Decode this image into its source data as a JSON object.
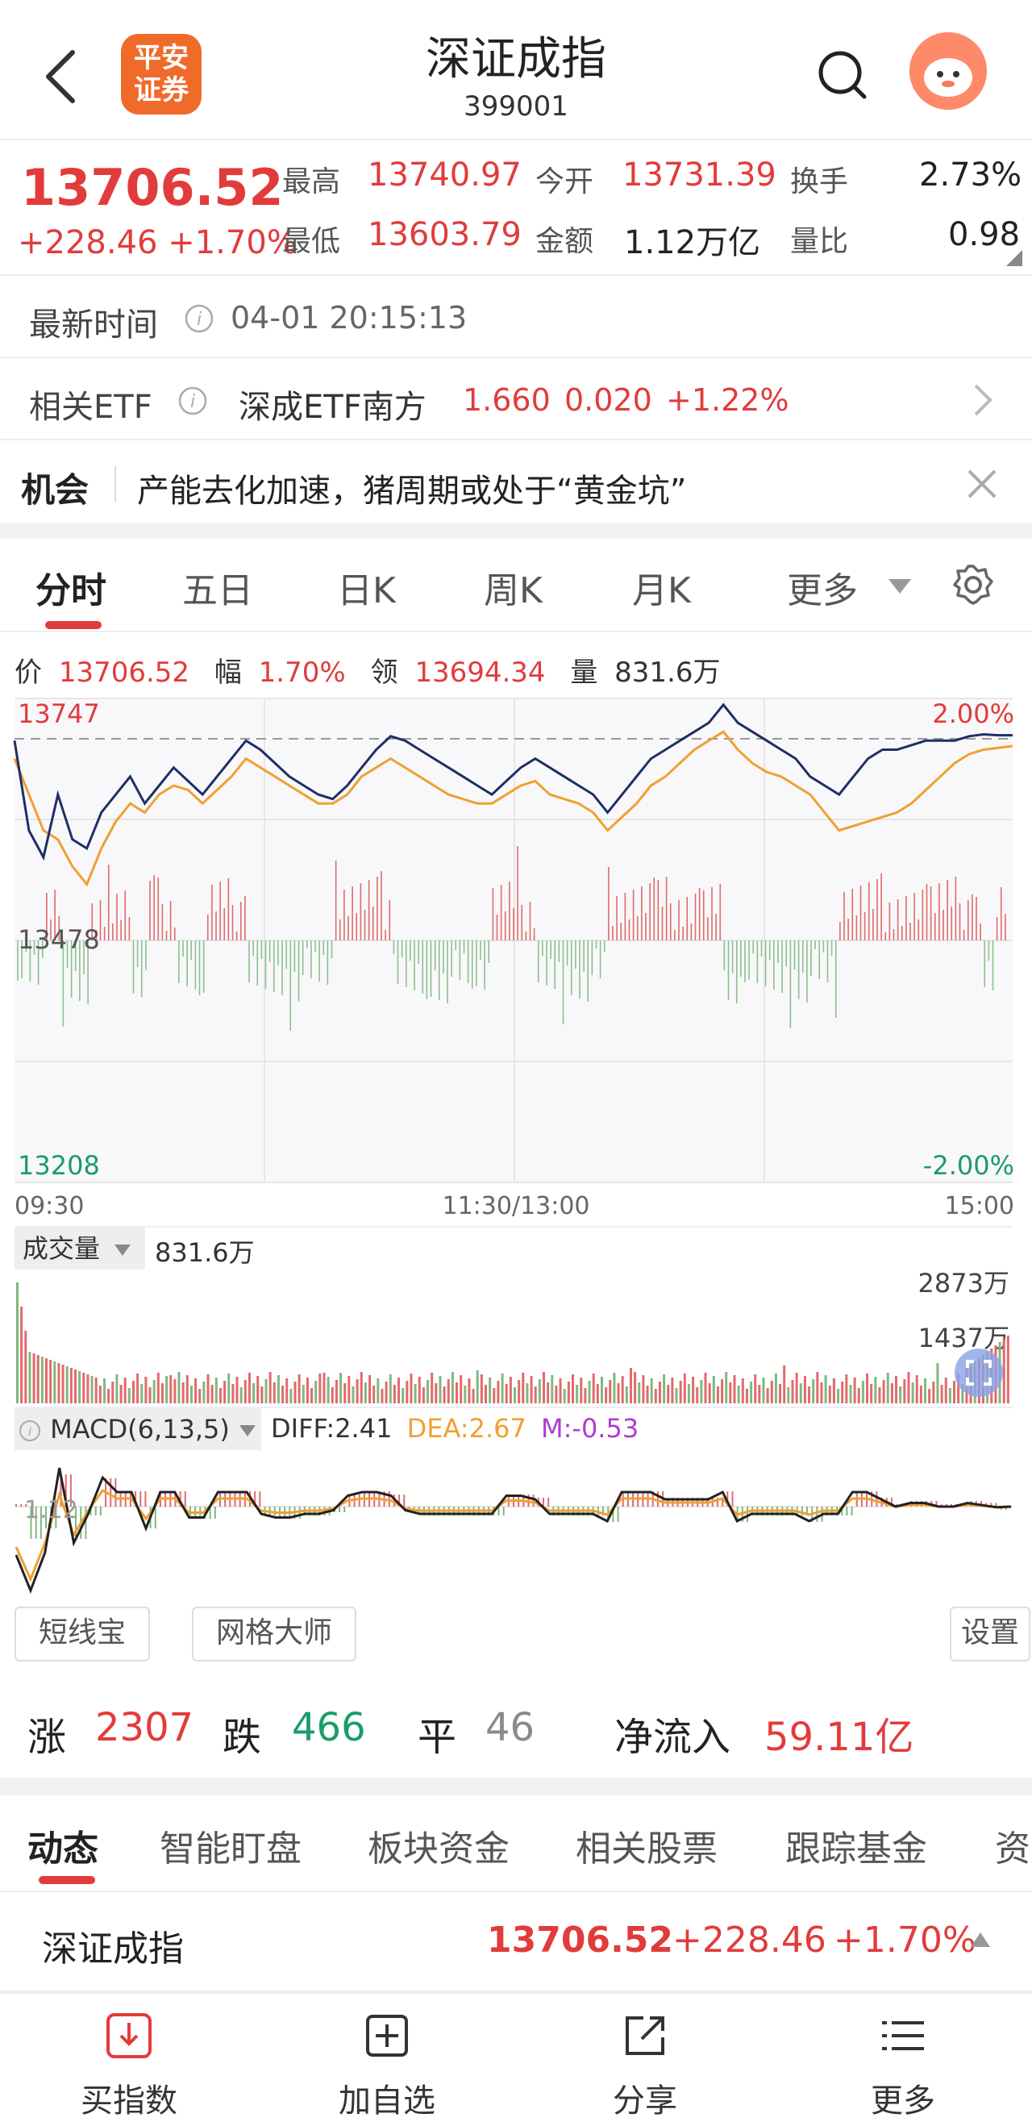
{
  "header": {
    "logo_line1": "平安",
    "logo_line2": "证券",
    "title": "深证成指",
    "code": "399001"
  },
  "quote": {
    "price": "13706.52",
    "change": "+228.46 +1.70%",
    "high_label": "最高",
    "high": "13740.97",
    "low_label": "最低",
    "low": "13603.79",
    "open_label": "今开",
    "open": "13731.39",
    "amount_label": "金额",
    "amount": "1.12万亿",
    "turnover_label": "换手",
    "turnover": "2.73%",
    "volratio_label": "量比",
    "volratio": "0.98"
  },
  "latest_time": {
    "label": "最新时间",
    "value": "04-01 20:15:13"
  },
  "etf": {
    "label": "相关ETF",
    "name": "深成ETF南方",
    "price": "1.660",
    "chg": "0.020",
    "pct": "+1.22%"
  },
  "opportunity": {
    "label": "机会",
    "text": "产能去化加速，猪周期或处于“黄金坑”"
  },
  "chart_tabs": [
    "分时",
    "五日",
    "日K",
    "周K",
    "月K",
    "更多"
  ],
  "info_line": {
    "price_label": "价",
    "price": "13706.52",
    "amp_label": "幅",
    "amp": "1.70%",
    "lead_label": "领",
    "lead": "13694.34",
    "vol_label": "量",
    "vol": "831.6万"
  },
  "intraday": {
    "top_price": "13747",
    "mid_price": "13478",
    "bottom_price": "13208",
    "top_pct": "2.00%",
    "bottom_pct": "-2.00%",
    "time_start": "09:30",
    "time_mid": "11:30/13:00",
    "time_end": "15:00"
  },
  "volume_panel": {
    "label": "成交量",
    "value": "831.6万",
    "max": "2873万",
    "mid": "1437万"
  },
  "macd_panel": {
    "label": "MACD(6,13,5)",
    "diff": "DIFF:2.41",
    "dea": "DEA:2.67",
    "m": "M:-0.53",
    "axis": "1.12"
  },
  "tool_buttons": {
    "short": "短线宝",
    "grid": "网格大师",
    "settings": "设置"
  },
  "breadth": {
    "up_label": "涨",
    "up": "2307",
    "down_label": "跌",
    "down": "466",
    "flat_label": "平",
    "flat": "46",
    "flow_label": "净流入",
    "flow": "59.11亿"
  },
  "news_tabs": [
    "动态",
    "智能盯盘",
    "板块资金",
    "相关股票",
    "跟踪基金",
    "资"
  ],
  "index_row": {
    "name": "深证成指",
    "price": "13706.52",
    "chg": "+228.46",
    "pct": "+1.70%"
  },
  "bottom_bar": [
    "买指数",
    "加自选",
    "分享",
    "更多"
  ],
  "chart_data": {
    "type": "line",
    "title": "",
    "xlabel": "",
    "ylabel": "",
    "x_ticks": [
      "09:30",
      "11:30/13:00",
      "15:00"
    ],
    "ylim": [
      13208,
      13747
    ],
    "y_ticks": [
      "13747",
      "13478",
      "13208"
    ],
    "right_ticks": [
      "2.00%",
      "-2.00%"
    ],
    "prev_close": 13478,
    "series": [
      {
        "name": "",
        "values": [
          13700,
          13600,
          13570,
          13640,
          13590,
          13580,
          13620,
          13640,
          13660,
          13630,
          13650,
          13670,
          13655,
          13640,
          13660,
          13680,
          13700,
          13690,
          13675,
          13660,
          13650,
          13640,
          13635,
          13650,
          13670,
          13690,
          13705,
          13700,
          13690,
          13680,
          13670,
          13660,
          13650,
          13640,
          13655,
          13670,
          13680,
          13670,
          13660,
          13650,
          13640,
          13620,
          13640,
          13660,
          13680,
          13690,
          13700,
          13710,
          13720,
          13740,
          13720,
          13710,
          13700,
          13690,
          13680,
          13660,
          13650,
          13640,
          13660,
          13680,
          13690,
          13690,
          13695,
          13700,
          13700,
          13700,
          13705,
          13707,
          13706,
          13706
        ]
      },
      {
        "name": "",
        "values": [
          13680,
          13640,
          13600,
          13590,
          13560,
          13540,
          13580,
          13610,
          13630,
          13620,
          13640,
          13650,
          13645,
          13630,
          13645,
          13660,
          13680,
          13670,
          13660,
          13650,
          13640,
          13630,
          13630,
          13640,
          13660,
          13670,
          13680,
          13670,
          13660,
          13650,
          13640,
          13635,
          13630,
          13630,
          13640,
          13650,
          13655,
          13640,
          13635,
          13630,
          13620,
          13600,
          13615,
          13630,
          13650,
          13660,
          13675,
          13690,
          13700,
          13710,
          13690,
          13675,
          13665,
          13660,
          13650,
          13640,
          13620,
          13600,
          13605,
          13610,
          13615,
          13620,
          13630,
          13645,
          13660,
          13675,
          13685,
          13690,
          13692,
          13694
        ]
      }
    ]
  }
}
